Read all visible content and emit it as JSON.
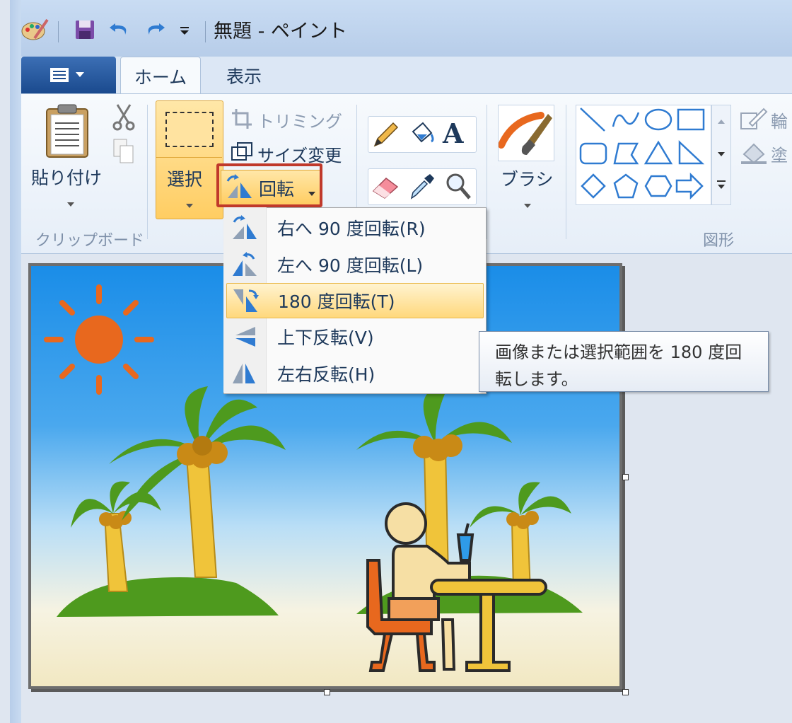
{
  "window": {
    "title": "無題 - ペイント"
  },
  "tabs": [
    {
      "label": "ホーム"
    },
    {
      "label": "表示"
    }
  ],
  "ribbon": {
    "clipboard": {
      "paste_label": "貼り付け",
      "group_label": "クリップボード"
    },
    "image": {
      "select_label": "選択",
      "crop_label": "トリミング",
      "resize_label": "サイズ変更",
      "rotate_label": "回転"
    },
    "brush": {
      "label": "ブラシ"
    },
    "shapes": {
      "group_label": "図形",
      "outline_label": "輪",
      "fill_label": "塗"
    }
  },
  "rotate_menu": {
    "items": [
      {
        "label": "右へ 90 度回転(R)",
        "icon": "rotate-right-icon"
      },
      {
        "label": "左へ 90 度回転(L)",
        "icon": "rotate-left-icon"
      },
      {
        "label": "180 度回転(T)",
        "icon": "rotate-180-icon",
        "highlighted": true
      },
      {
        "label": "上下反転(V)",
        "icon": "flip-vertical-icon"
      },
      {
        "label": "左右反転(H)",
        "icon": "flip-horizontal-icon"
      }
    ],
    "tooltip": "画像または選択範囲を 180 度回転します。"
  },
  "colors": {
    "accent_highlight": "#ffd87c",
    "callout_border": "#c0392b",
    "sun": "#e8681e",
    "palm": "#4e9a1e"
  }
}
